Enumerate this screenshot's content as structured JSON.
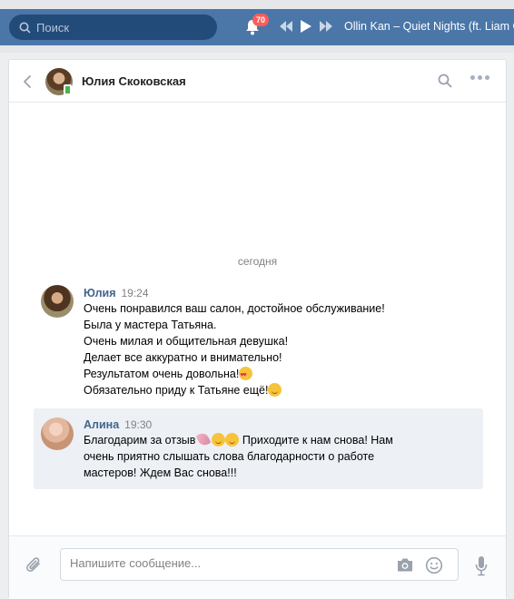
{
  "topbar": {
    "search_placeholder": "Поиск",
    "notifications_count": "70",
    "now_playing": "Ollin Kan – Quiet Nights (ft. Liam G"
  },
  "chat": {
    "contact_name": "Юлия Скоковская",
    "date_divider": "сегодня",
    "messages": [
      {
        "author": "Юлия",
        "time": "19:24",
        "lines": [
          "Очень понравился ваш салон, достойное обслуживание!",
          "Была у мастера Татьяна.",
          "Очень милая и общительная девушка!",
          "Делает все аккуратно и внимательно!",
          "Результатом очень довольна!",
          "Обязательно приду к Татьяне ещё!"
        ]
      },
      {
        "author": "Алина",
        "time": "19:30",
        "lines": [
          "Благодарим за отзыв",
          " Приходите к нам снова! Нам",
          "очень приятно слышать слова благодарности о работе",
          "мастеров! Ждем Вас снова!!!"
        ]
      }
    ]
  },
  "composer": {
    "placeholder": "Напишите сообщение..."
  },
  "colors": {
    "header_blue": "#4a76a8",
    "author_link": "#42648b",
    "unread_bg": "#edf0f5",
    "badge_red": "#ff5c5c"
  },
  "icons": [
    "search-icon",
    "bell-icon",
    "prev-track-icon",
    "play-icon",
    "next-track-icon",
    "back-arrow-icon",
    "more-icon",
    "attach-icon",
    "camera-icon",
    "emoji-icon",
    "microphone-icon"
  ]
}
